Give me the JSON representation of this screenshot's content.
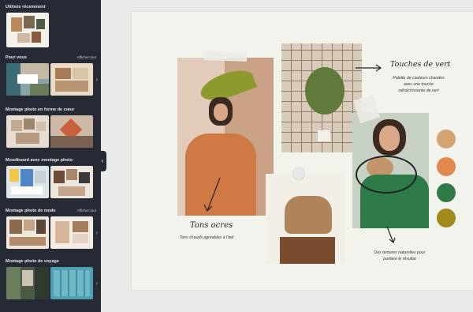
{
  "sidebar": {
    "recent_title": "Utilisés récemment",
    "sections": [
      {
        "title": "Pour vous",
        "see_all": "Afficher tout"
      },
      {
        "title": "Montage photo en forme de cœur",
        "see_all": "Afficher tout"
      },
      {
        "title": "Moodboard avec montage photo",
        "see_all": "Afficher tout"
      },
      {
        "title": "Montage photo de mode",
        "see_all": "Afficher tout"
      },
      {
        "title": "Montage photo de voyage",
        "see_all": "Afficher tout"
      }
    ]
  },
  "board": {
    "touches_title": "Touches de vert",
    "touches_desc_1": "Palette de couleurs chaudes",
    "touches_desc_2": "avec une touche",
    "touches_desc_3": "rafraîchissante de vert",
    "ocres_title": "Tons ocres",
    "ocres_desc": "Tons chauds agréables à l'œil",
    "textures_1": "Des textures naturelles pour",
    "textures_2": "parfaire le résultat",
    "swatch_colors": [
      "#d4a373",
      "#e2894e",
      "#2f7a46",
      "#a08a1c"
    ]
  }
}
